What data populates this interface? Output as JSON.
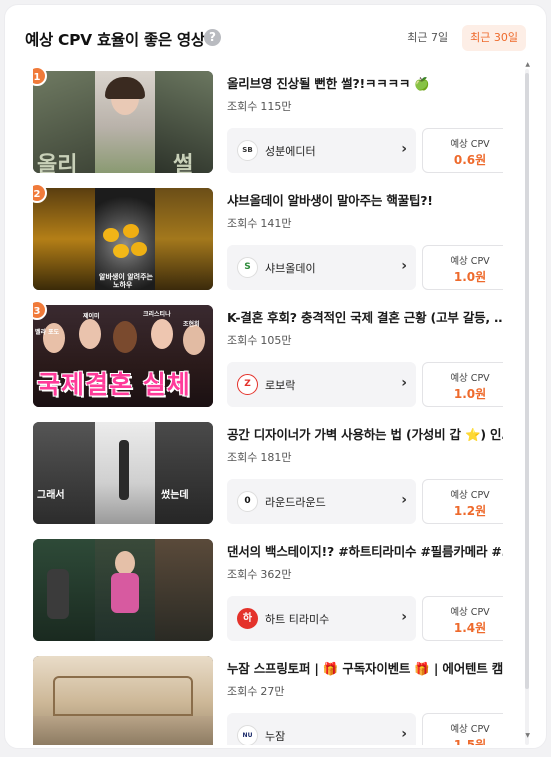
{
  "header": {
    "title": "예상 CPV 효율이 좋은 영상",
    "help": "?",
    "tabs": [
      {
        "label": "최근 7일",
        "active": false
      },
      {
        "label": "최근 30일",
        "active": true
      }
    ]
  },
  "labels": {
    "views_prefix": "조회수",
    "cpv_label": "예상 CPV"
  },
  "colors": {
    "accent": "#ee6a2c",
    "rank_badge": "#f07a3a",
    "tab_active_bg": "#fdeee6"
  },
  "videos": [
    {
      "rank": "1",
      "title": "올리브영 진상될 뻔한 썰?!ㅋㅋㅋㅋ 🍏",
      "views": "115만",
      "channel": "성분에디터",
      "channel_logo_text": "SB",
      "cpv": "0.6원",
      "thumb_text": [
        "올리",
        "썰"
      ]
    },
    {
      "rank": "2",
      "title": "샤브올데이 알바생이 말아주는 핵꿀팁?!",
      "views": "141만",
      "channel": "샤브올데이",
      "channel_logo_text": "S",
      "cpv": "1.0원",
      "thumb_text": [
        "알바생이 알려주는",
        "노하우"
      ]
    },
    {
      "rank": "3",
      "title": "K-결혼 후회? 충격적인 국제 결혼 근황 (고부 갈등, 시월드, 문화차이)",
      "views": "105만",
      "channel": "로보락",
      "channel_logo_text": "Z",
      "cpv": "1.0원",
      "thumb_text": [
        "국제결혼 실체",
        "벨라 포도",
        "제이미",
        "크리스티나",
        "조현희"
      ]
    },
    {
      "rank": "",
      "title": "공간 디자이너가 가벽 사용하는 법 (가성비 갑 ⭐) 인테리어 꿀팁",
      "views": "181만",
      "channel": "라운드라운드",
      "channel_logo_text": "0",
      "cpv": "1.2원",
      "thumb_text": [
        "그래서",
        "썼는데"
      ]
    },
    {
      "rank": "",
      "title": "댄서의 백스테이지!? #하트티라미수 #필름카메라 #댄서",
      "views": "362만",
      "channel": "하트 티라미수",
      "channel_logo_text": "하",
      "cpv": "1.4원",
      "thumb_text": []
    },
    {
      "rank": "",
      "title": "누잠 스프링토퍼 | 🎁 구독자이벤트 🎁 | 에어텐트 캠핑",
      "views": "27만",
      "channel": "누잠",
      "channel_logo_text": "NU",
      "cpv": "1.5원",
      "thumb_text": []
    }
  ]
}
